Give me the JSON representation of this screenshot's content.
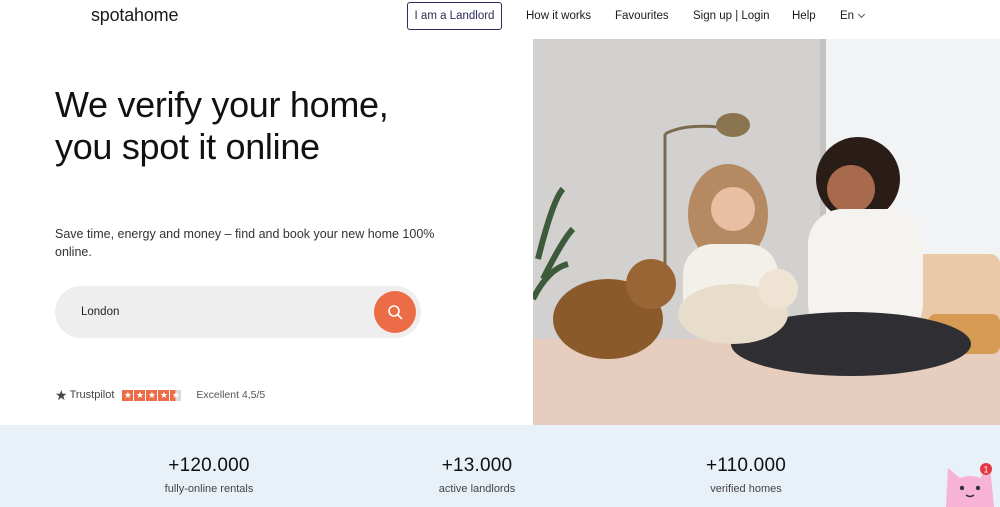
{
  "header": {
    "logo": "spotahome",
    "landlord_button": "I am a Landlord",
    "nav": {
      "how_it_works": "How it works",
      "favourites": "Favourites",
      "sign_up_login": "Sign up | Login",
      "help": "Help",
      "language": "En"
    }
  },
  "hero": {
    "title": "We verify your home, you spot it online",
    "subtitle": "Save time, energy and money – find and book your new home 100% online.",
    "search": {
      "value": "London",
      "icon": "search-icon"
    },
    "trustpilot": {
      "brand": "Trustpilot",
      "rating_text": "Excellent 4,5/5",
      "stars": 4.5
    },
    "image_icon": "photo-two-women-dogs"
  },
  "stats": [
    {
      "value": "+120.000",
      "label": "fully-online rentals"
    },
    {
      "value": "+13.000",
      "label": "active landlords"
    },
    {
      "value": "+110.000",
      "label": "verified homes"
    }
  ],
  "chat": {
    "badge": "1",
    "icon": "cat-mascot-icon"
  },
  "colors": {
    "accent": "#ec6c47",
    "landlord_border": "#2b2d5a",
    "stats_bg": "#e9f1f8",
    "search_bg": "#eeeeee"
  }
}
